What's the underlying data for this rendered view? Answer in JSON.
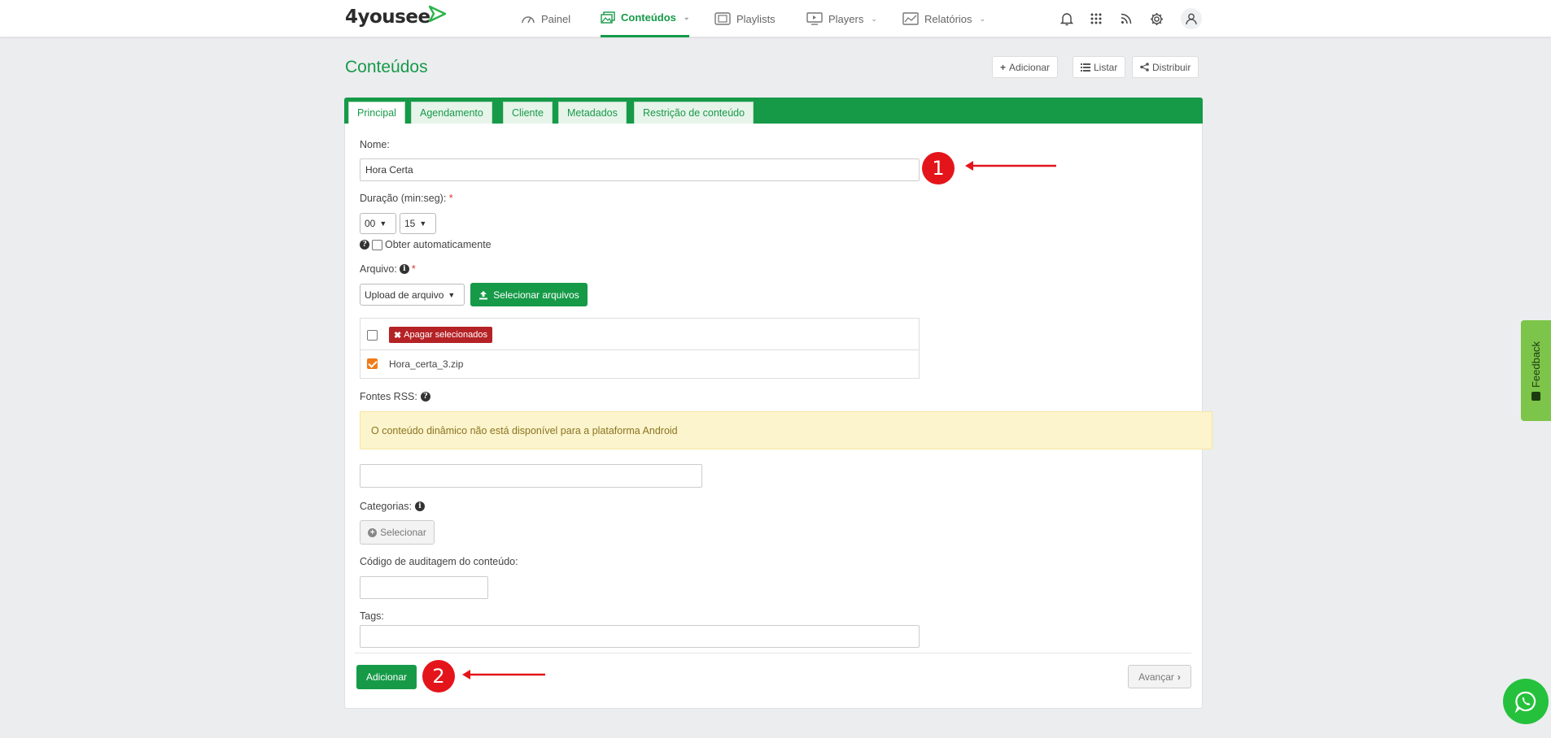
{
  "brand": {
    "name": "4yousee"
  },
  "nav": {
    "items": [
      {
        "label": "Painel"
      },
      {
        "label": "Conteúdos"
      },
      {
        "label": "Playlists"
      },
      {
        "label": "Players"
      },
      {
        "label": "Relatórios"
      }
    ],
    "active": "Conteúdos",
    "icons": [
      "bell-icon",
      "apps-grid-icon",
      "rss-icon",
      "gear-icon",
      "user-icon"
    ]
  },
  "page": {
    "title": "Conteúdos",
    "actions": {
      "add": "Adicionar",
      "list": "Listar",
      "distribute": "Distribuir"
    }
  },
  "tabs": [
    "Principal",
    "Agendamento",
    "Cliente",
    "Metadados",
    "Restrição de conteúdo"
  ],
  "form": {
    "name": {
      "label": "Nome:",
      "value": "Hora Certa"
    },
    "duration": {
      "label": "Duração (min:seg):",
      "required": "*",
      "minutes": "00",
      "seconds": "15"
    },
    "auto": {
      "label": "Obter automaticamente"
    },
    "file": {
      "label": "Arquivo:",
      "required": "*",
      "source": "Upload de arquivo",
      "select_button": "Selecionar arquivos",
      "delete_button": "Apagar selecionados",
      "files": [
        {
          "name": "Hora_certa_3.zip",
          "checked": true
        }
      ]
    },
    "rss": {
      "label": "Fontes RSS:",
      "alert": "O conteúdo dinâmico não está disponível para a plataforma Android",
      "value": ""
    },
    "categories": {
      "label": "Categorias:",
      "button": "Selecionar"
    },
    "audit_code": {
      "label": "Código de auditagem do conteúdo:",
      "value": ""
    },
    "tags": {
      "label": "Tags:",
      "value": ""
    }
  },
  "footer": {
    "submit": "Adicionar",
    "next": "Avançar"
  },
  "annotations": {
    "first": "1",
    "second": "2"
  },
  "feedback": {
    "label": "Feedback"
  },
  "colors": {
    "accent": "#169a48",
    "danger": "#b52226",
    "annotation": "#e4141b",
    "alert_bg": "#fcf4cc"
  }
}
